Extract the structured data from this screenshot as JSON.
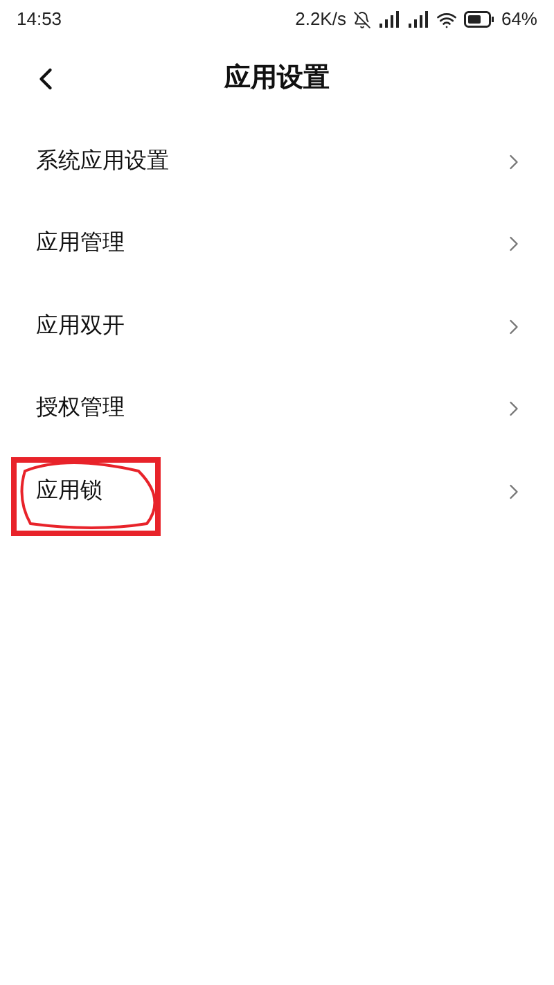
{
  "status_bar": {
    "time": "14:53",
    "net_speed": "2.2K/s",
    "battery": "64%"
  },
  "header": {
    "title": "应用设置"
  },
  "items": [
    {
      "label": "系统应用设置",
      "annotated": false
    },
    {
      "label": "应用管理",
      "annotated": false
    },
    {
      "label": "应用双开",
      "annotated": false
    },
    {
      "label": "授权管理",
      "annotated": false
    },
    {
      "label": "应用锁",
      "annotated": true
    }
  ]
}
